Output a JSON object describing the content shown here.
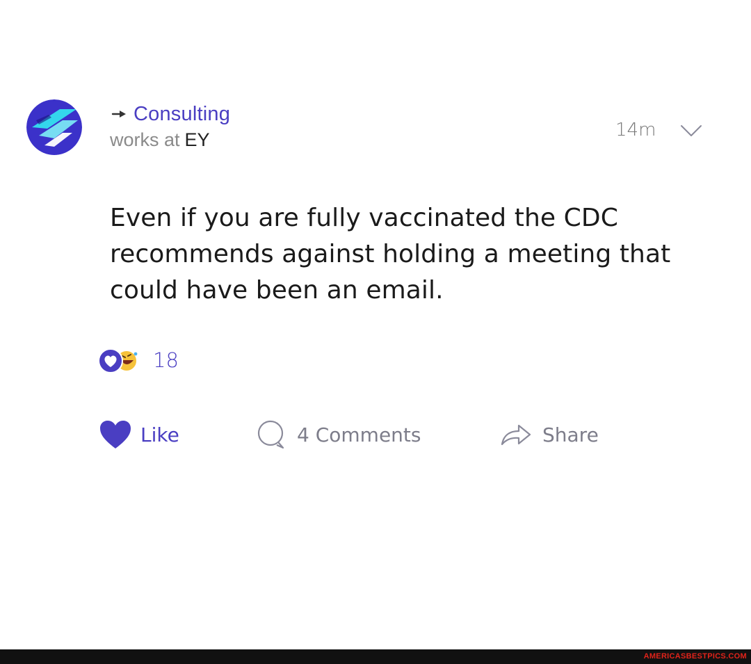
{
  "post": {
    "channel": "Consulting",
    "works_at_prefix": "works at",
    "company": "EY",
    "timestamp": "14m",
    "body_lines": [
      "Even if you are fully vaccinated the CDC",
      "recommends against holding a meeting that",
      "could have been an email."
    ],
    "reactions": {
      "count": "18",
      "icons": [
        "heart-reaction-icon",
        "laugh-reaction-icon"
      ]
    }
  },
  "actions": {
    "like_label": "Like",
    "comments_label": "4 Comments",
    "share_label": "Share"
  },
  "colors": {
    "accent": "#4a3ec2",
    "muted": "#7d7d8a",
    "avatar_bg": "#3b31c9",
    "avatar_highlight": "#34e0ee"
  },
  "watermark": "AMERICASBESTPICS.COM"
}
